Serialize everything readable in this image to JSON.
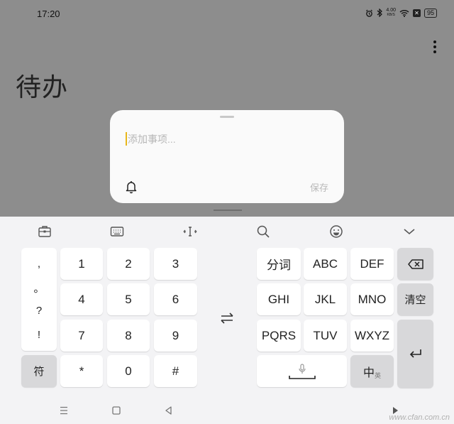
{
  "status_bar": {
    "time": "17:20",
    "net_speed_value": "4.00",
    "net_speed_unit": "KB/S",
    "battery": "95"
  },
  "page": {
    "title": "待办"
  },
  "new_todo_dialog": {
    "placeholder": "添加事项...",
    "save_label": "保存"
  },
  "keyboard": {
    "punctuation": [
      ",",
      "。",
      "?",
      "!"
    ],
    "symbol_key": "符",
    "number_keys": [
      "1",
      "2",
      "3",
      "4",
      "5",
      "6",
      "7",
      "8",
      "9",
      "*",
      "0",
      "#"
    ],
    "pinyin_keys": {
      "segment": "分词",
      "abc": "ABC",
      "def": "DEF",
      "ghi": "GHI",
      "jkl": "JKL",
      "mno": "MNO",
      "pqrs": "PQRS",
      "tuv": "TUV",
      "wxyz": "WXYZ",
      "clear": "清空",
      "lang_main": "中",
      "lang_sub": "英"
    }
  },
  "watermark": "www.cfan.com.cn",
  "icons": {
    "toolbar": [
      "clipboard-icon",
      "keyboard-icon",
      "cursor-icon",
      "search-icon",
      "emoji-icon",
      "chevron-down-icon"
    ]
  },
  "colors": {
    "caret": "#e8b71a",
    "overlay": "#8d8d8d",
    "keyboard_bg": "#f3f3f5"
  }
}
